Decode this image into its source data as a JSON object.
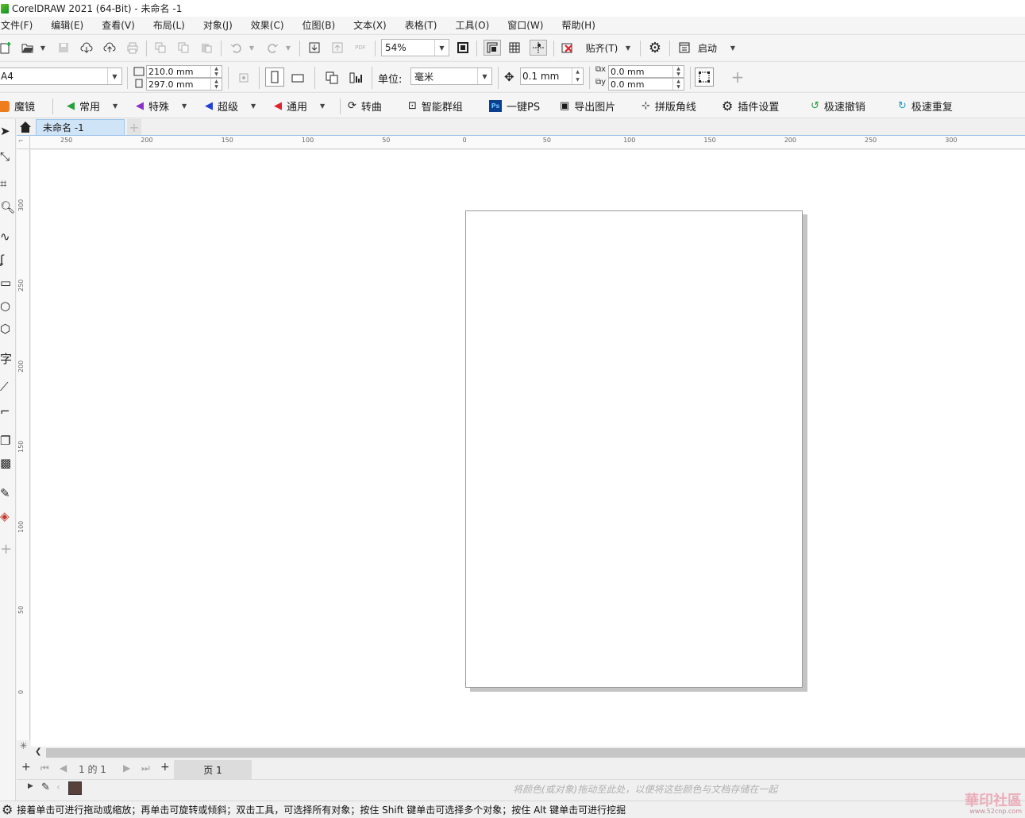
{
  "titlebar": {
    "title": "CorelDRAW 2021 (64-Bit) - 未命名 -1"
  },
  "menu": [
    "文件(F)",
    "编辑(E)",
    "查看(V)",
    "布局(L)",
    "对象(J)",
    "效果(C)",
    "位图(B)",
    "文本(X)",
    "表格(T)",
    "工具(O)",
    "窗口(W)",
    "帮助(H)"
  ],
  "std_toolbar": {
    "zoom_value": "54%",
    "snap_label": "贴齐(T)",
    "launch_label": "启动"
  },
  "prop_bar": {
    "page_size": "A4",
    "width": "210.0 mm",
    "height": "297.0 mm",
    "unit_label": "单位:",
    "unit_value": "毫米",
    "nudge": "0.1 mm",
    "dup_x": "0.0 mm",
    "dup_y": "0.0 mm"
  },
  "plugins": [
    {
      "label": "魔镜",
      "icon": "magic-mirror-icon",
      "color": "#f07d1d"
    },
    {
      "label": "常用",
      "icon": "arrow-green-icon",
      "color": "#27a23b"
    },
    {
      "label": "特殊",
      "icon": "arrow-purple-icon",
      "color": "#8b2fc9"
    },
    {
      "label": "超级",
      "icon": "arrow-blue-icon",
      "color": "#2140d6"
    },
    {
      "label": "通用",
      "icon": "arrow-red-icon",
      "color": "#e0202b"
    },
    {
      "label": "转曲",
      "icon": "convert-curve-icon",
      "color": "#333333"
    },
    {
      "label": "智能群组",
      "icon": "smart-group-icon",
      "color": "#333333"
    },
    {
      "label": "一键PS",
      "icon": "ps-icon",
      "color": "#0a3e8f"
    },
    {
      "label": "导出图片",
      "icon": "export-image-icon",
      "color": "#333333"
    },
    {
      "label": "拼版角线",
      "icon": "crop-marks-icon",
      "color": "#333333"
    },
    {
      "label": "插件设置",
      "icon": "gear-icon",
      "color": "#222222"
    },
    {
      "label": "极速撤销",
      "icon": "undo-green-icon",
      "color": "#1e9e3d"
    },
    {
      "label": "极速重复",
      "icon": "redo-cyan-icon",
      "color": "#1aa0c8"
    }
  ],
  "doc_tabs": {
    "active": "未命名 -1"
  },
  "ruler_h": [
    "250",
    "200",
    "150",
    "100",
    "50",
    "0",
    "50",
    "100",
    "150",
    "200",
    "250",
    "300"
  ],
  "ruler_v": [
    "300",
    "250",
    "200",
    "150",
    "100",
    "50",
    "0"
  ],
  "pagenav": {
    "page_count": "1 的 1",
    "page_tab": "页 1"
  },
  "colorbar": {
    "hint": "将颜色(或对象)拖动至此处，以便将这些颜色与文档存储在一起"
  },
  "statusbar": {
    "text": "接着单击可进行拖动或缩放；再单击可旋转或倾斜；双击工具，可选择所有对象；按住 Shift 键单击可选择多个对象；按住 Alt 键单击可进行挖掘"
  },
  "watermark": {
    "text": "華印社區",
    "url": "www.52cnp.com"
  }
}
